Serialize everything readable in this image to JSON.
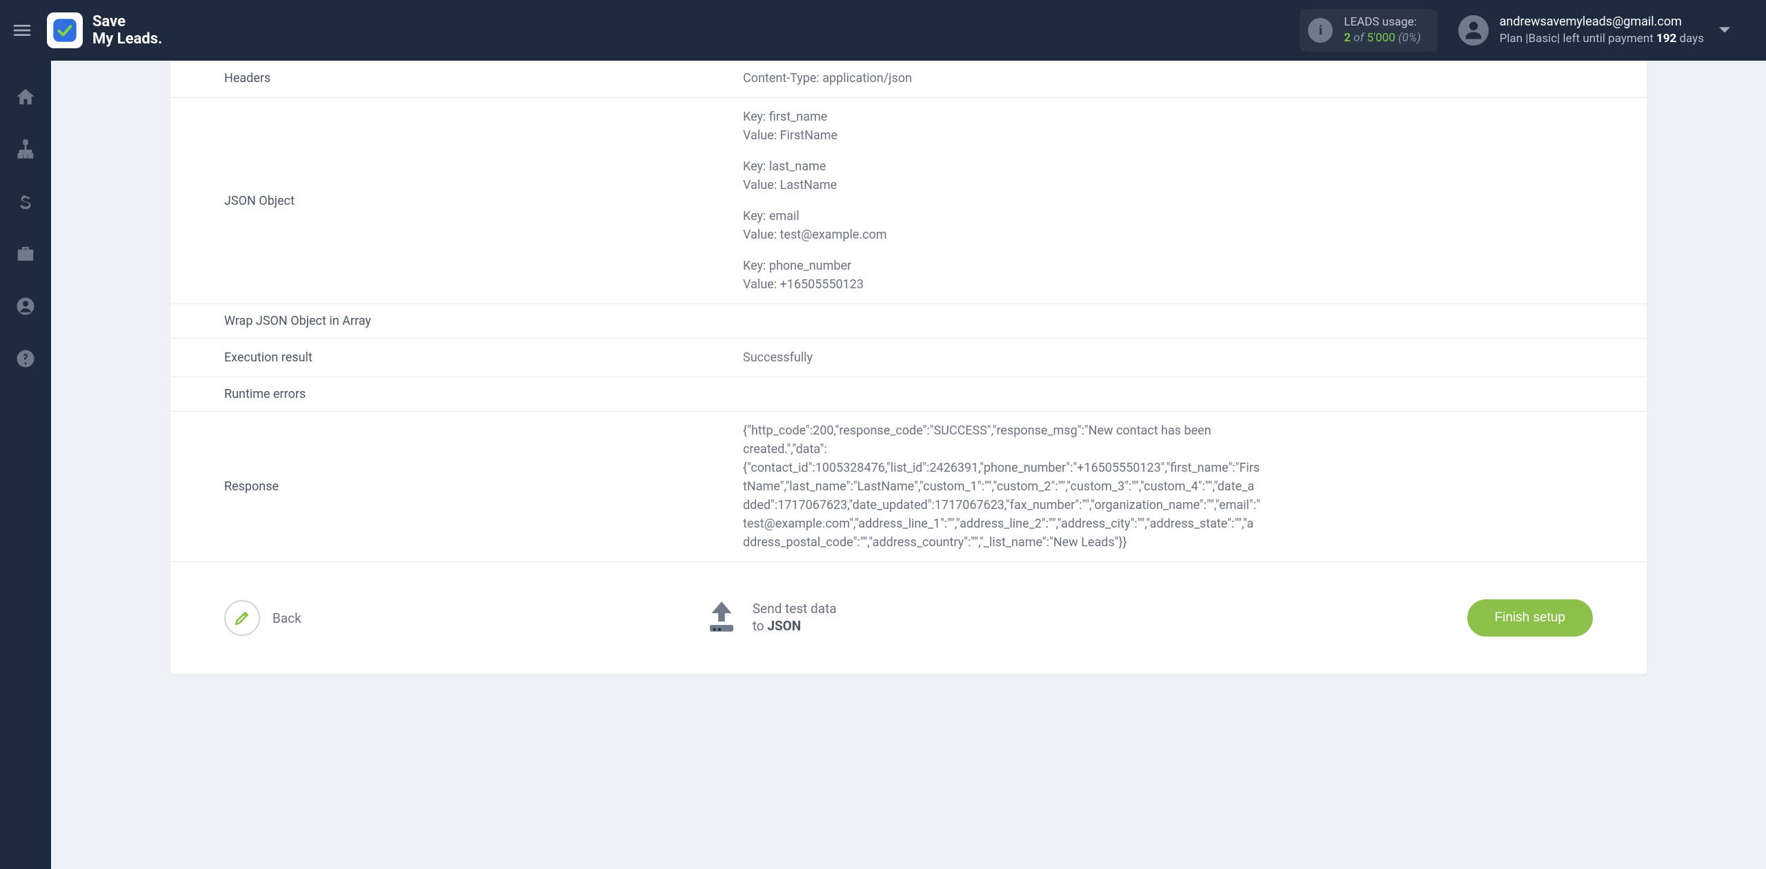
{
  "header": {
    "logo_line1": "Save",
    "logo_line2": "My Leads.",
    "usage": {
      "title": "LEADS usage:",
      "count": "2",
      "of": "of",
      "total": "5'000",
      "pct": "(0%)"
    },
    "account": {
      "email": "andrewsavemyleads@gmail.com",
      "plan_prefix": "Plan |",
      "plan_name": "Basic",
      "plan_mid": "| left until payment ",
      "days_num": "192",
      "days_suffix": " days"
    }
  },
  "details": {
    "headers": {
      "label": "Headers",
      "value": "Content-Type: application/json"
    },
    "json_object": {
      "label": "JSON Object",
      "pairs": [
        {
          "key_label": "Key: first_name",
          "value_label": "Value: FirstName"
        },
        {
          "key_label": "Key: last_name",
          "value_label": "Value: LastName"
        },
        {
          "key_label": "Key: email",
          "value_label": "Value: test@example.com"
        },
        {
          "key_label": "Key: phone_number",
          "value_label": "Value: +16505550123"
        }
      ]
    },
    "wrap_array": {
      "label": "Wrap JSON Object in Array",
      "value": ""
    },
    "execution_result": {
      "label": "Execution result",
      "value": "Successfully"
    },
    "runtime_errors": {
      "label": "Runtime errors",
      "value": ""
    },
    "response": {
      "label": "Response",
      "value": "{\"http_code\":200,\"response_code\":\"SUCCESS\",\"response_msg\":\"New contact has been created.\",\"data\":{\"contact_id\":1005328476,\"list_id\":2426391,\"phone_number\":\"+16505550123\",\"first_name\":\"FirstName\",\"last_name\":\"LastName\",\"custom_1\":\"\",\"custom_2\":\"\",\"custom_3\":\"\",\"custom_4\":\"\",\"date_added\":1717067623,\"date_updated\":1717067623,\"fax_number\":\"\",\"organization_name\":\"\",\"email\":\"test@example.com\",\"address_line_1\":\"\",\"address_line_2\":\"\",\"address_city\":\"\",\"address_state\":\"\",\"address_postal_code\":\"\",\"address_country\":\"\",\"_list_name\":\"New Leads\"}}"
    }
  },
  "actions": {
    "back": "Back",
    "send_line1": "Send test data",
    "send_line2_prefix": "to ",
    "send_line2_bold": "JSON",
    "finish": "Finish setup"
  }
}
